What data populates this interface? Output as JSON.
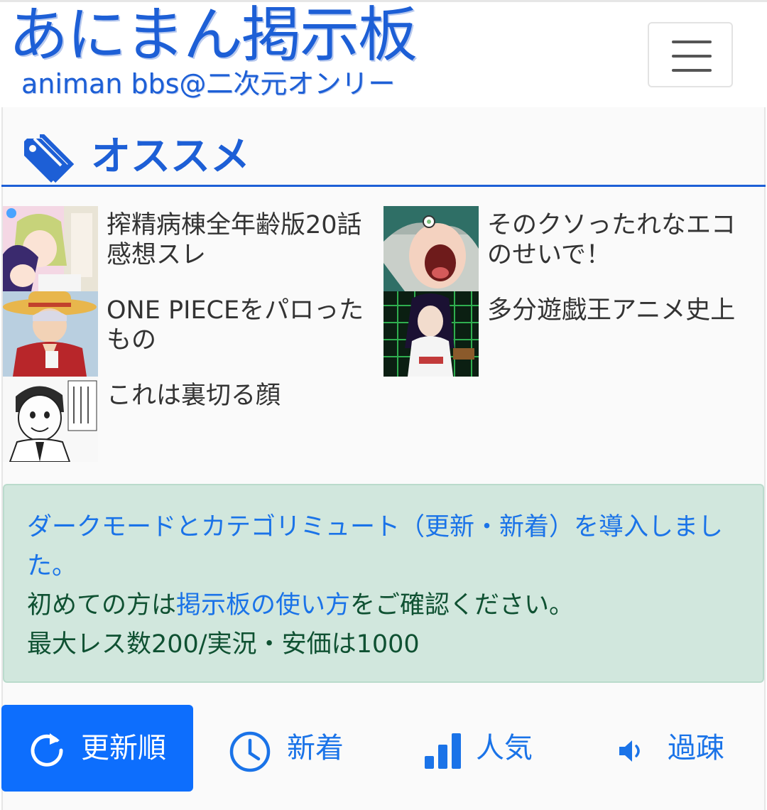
{
  "header": {
    "logo_main": "あにまん掲示板",
    "logo_sub": "animan bbs@二次元オンリー",
    "menu_icon": "hamburger-icon"
  },
  "section": {
    "title": "オススメ",
    "icon": "tag-icon",
    "accent_color": "#1d5fd6"
  },
  "recommendations": [
    {
      "title": "搾精病棟全年齢版20話感想スレ"
    },
    {
      "title": "そのクソったれなエコのせいで！"
    },
    {
      "title": "ONE PIECEをパロったもの"
    },
    {
      "title": "多分遊戯王アニメ史上"
    },
    {
      "title": "これは裏切る顔"
    }
  ],
  "notice": {
    "line1_link": "ダークモードとカテゴリミュート（更新・新着）を導入しました。",
    "line2_before": "初めての方は",
    "line2_link": "掲示板の使い方",
    "line2_after": "をご確認ください。",
    "line3": "最大レス数200/実況・安価は1000"
  },
  "tabs": [
    {
      "label": "更新順",
      "icon": "refresh-icon",
      "active": true
    },
    {
      "label": "新着",
      "icon": "clock-icon",
      "active": false
    },
    {
      "label": "人気",
      "icon": "bar-chart-icon",
      "active": false
    },
    {
      "label": "過疎",
      "icon": "speaker-icon",
      "active": false
    }
  ]
}
